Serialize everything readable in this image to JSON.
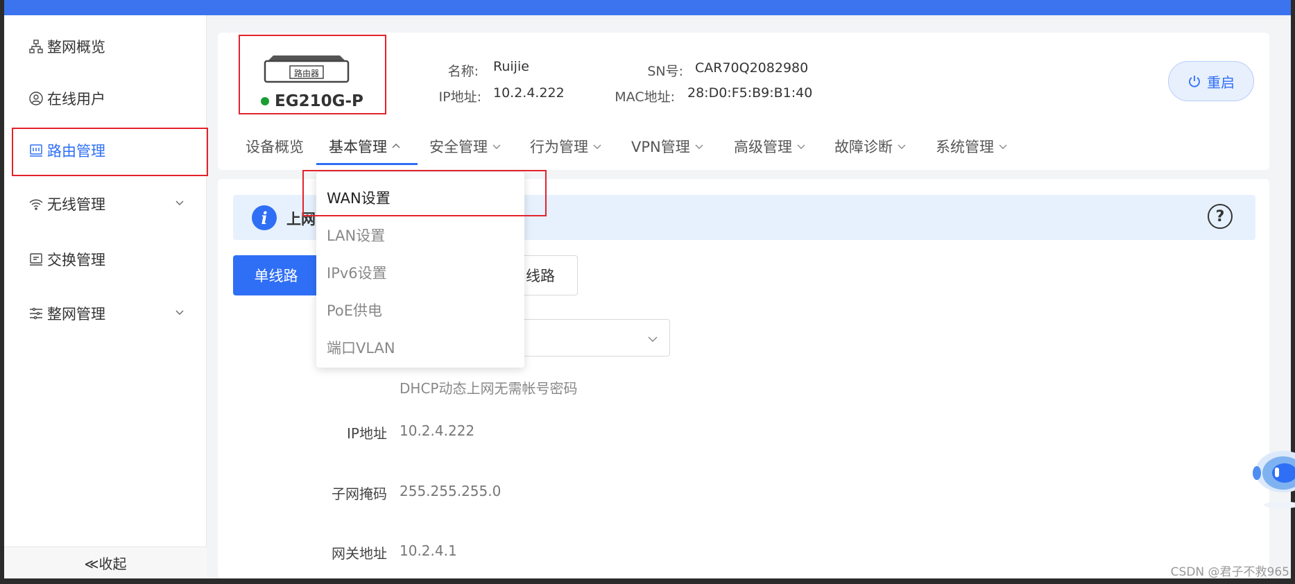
{
  "sidebar": {
    "items": [
      {
        "label": "整网概览",
        "icon": "network-topology-icon"
      },
      {
        "label": "在线用户",
        "icon": "user-circle-icon"
      },
      {
        "label": "路由管理",
        "icon": "router-icon"
      },
      {
        "label": "无线管理",
        "icon": "wifi-icon"
      },
      {
        "label": "交换管理",
        "icon": "switch-icon"
      },
      {
        "label": "整网管理",
        "icon": "settings-list-icon"
      }
    ],
    "collapse_label": "≪收起"
  },
  "device": {
    "image_label": "路由器",
    "model": "EG210G-P",
    "status_color": "#1a9e32",
    "name_label": "名称:",
    "name_value": "Ruijie",
    "ip_label": "IP地址:",
    "ip_value": "10.2.4.222",
    "sn_label": "SN号:",
    "sn_value": "CAR70Q2082980",
    "mac_label": "MAC地址:",
    "mac_value": "28:D0:F5:B9:B1:40",
    "restart_label": "重启"
  },
  "tabs": [
    {
      "label": "设备概览",
      "has_chevron": false
    },
    {
      "label": "基本管理",
      "has_chevron": true,
      "active": true
    },
    {
      "label": "安全管理",
      "has_chevron": true
    },
    {
      "label": "行为管理",
      "has_chevron": true
    },
    {
      "label": "VPN管理",
      "has_chevron": true
    },
    {
      "label": "高级管理",
      "has_chevron": true
    },
    {
      "label": "故障诊断",
      "has_chevron": true
    },
    {
      "label": "系统管理",
      "has_chevron": true
    }
  ],
  "dropdown": {
    "items": [
      {
        "label": "WAN设置",
        "active": true
      },
      {
        "label": "LAN设置"
      },
      {
        "label": "IPv6设置"
      },
      {
        "label": "PoE供电"
      },
      {
        "label": "端口VLAN"
      }
    ]
  },
  "content": {
    "banner_text": "上网",
    "help_icon": "?",
    "seg_active": "单线路",
    "seg_other": "多线路",
    "seg_other_visible": "线路",
    "hint": "DHCP动态上网无需帐号密码",
    "fields": [
      {
        "label": "IP地址",
        "value": "10.2.4.222"
      },
      {
        "label": "子网掩码",
        "value": "255.255.255.0"
      },
      {
        "label": "网关地址",
        "value": "10.2.4.1"
      }
    ]
  },
  "watermark": "CSDN @君子不救965",
  "colors": {
    "accent": "#2f6ff5",
    "highlight": "#e3222b",
    "topbar": "#3b74ee"
  }
}
